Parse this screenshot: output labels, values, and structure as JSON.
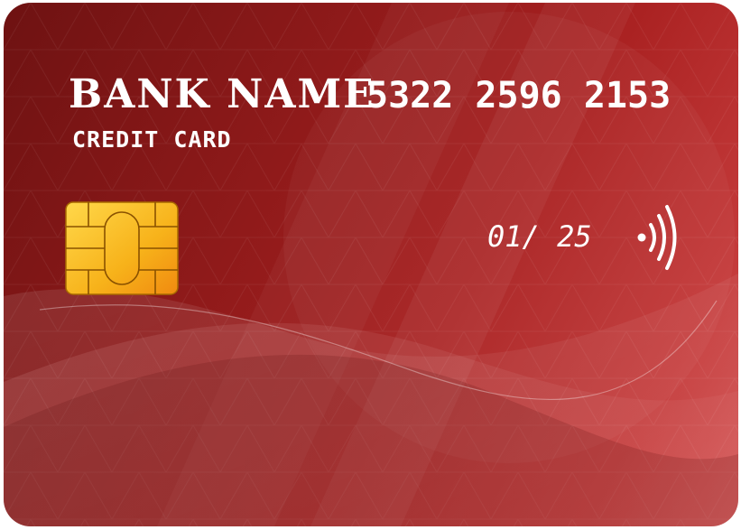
{
  "card": {
    "bank_name": "BANK NAME",
    "card_type": "CREDIT CARD",
    "number": "5322 2596 2153",
    "expiry": "01/ 25"
  },
  "icons": {
    "chip": "chip-icon",
    "contactless": "contactless-icon"
  },
  "colors": {
    "card_base": "#8f1a1a",
    "card_highlight": "#d65a5a",
    "text": "#ffffff",
    "chip_gold": "#f4b400"
  }
}
